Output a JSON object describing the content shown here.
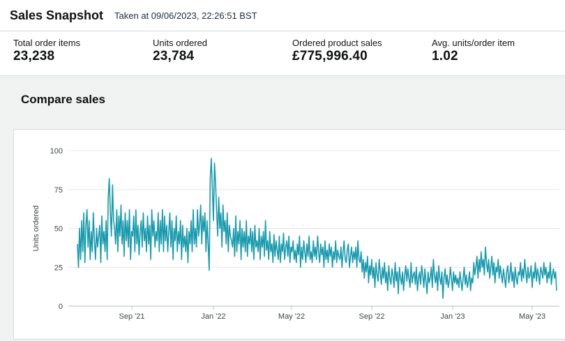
{
  "header": {
    "title": "Sales Snapshot",
    "taken_at": "Taken at 09/06/2023, 22:26:51 BST"
  },
  "metrics": [
    {
      "label": "Total order items",
      "value": "23,238"
    },
    {
      "label": "Units ordered",
      "value": "23,784"
    },
    {
      "label": "Ordered product sales",
      "value": "£775,996.40"
    },
    {
      "label": "Avg. units/order item",
      "value": "1.02"
    }
  ],
  "compare": {
    "title": "Compare sales"
  },
  "colors": {
    "line": "#1a9aad",
    "grid": "#e3e6e6",
    "axis": "#bbbfbf"
  },
  "chart_data": {
    "type": "line",
    "title": "",
    "xlabel": "",
    "ylabel": "Units ordered",
    "ylim": [
      0,
      100
    ],
    "y_ticks": [
      "0",
      "25",
      "50",
      "75",
      "100"
    ],
    "x_ticks": [
      "Sep '21",
      "Jan '22",
      "May '22",
      "Sep '22",
      "Jan '23",
      "May '23"
    ],
    "grid": true,
    "series": [
      {
        "values": [
          40,
          25,
          50,
          30,
          55,
          35,
          60,
          28,
          52,
          62,
          38,
          55,
          30,
          48,
          35,
          60,
          42,
          30,
          50,
          38,
          45,
          52,
          28,
          58,
          40,
          48,
          35,
          55,
          30,
          70,
          82,
          60,
          45,
          78,
          55,
          50,
          40,
          62,
          35,
          58,
          45,
          65,
          40,
          55,
          32,
          60,
          42,
          55,
          38,
          62,
          30,
          48,
          45,
          58,
          35,
          62,
          40,
          52,
          33,
          48,
          55,
          38,
          60,
          42,
          50,
          35,
          58,
          40,
          52,
          30,
          62,
          45,
          55,
          38,
          48,
          42,
          60,
          35,
          55,
          40,
          62,
          35,
          58,
          42,
          52,
          35,
          48,
          60,
          38,
          55,
          30,
          50,
          42,
          58,
          35,
          48,
          40,
          55,
          30,
          52,
          38,
          45,
          35,
          50,
          28,
          48,
          40,
          55,
          35,
          62,
          40,
          50,
          38,
          62,
          45,
          52,
          65,
          40,
          58,
          48,
          60,
          35,
          55,
          40,
          23,
          82,
          95,
          75,
          55,
          92,
          80,
          62,
          45,
          70,
          50,
          60,
          38,
          65,
          48,
          55,
          40,
          60,
          35,
          52,
          45,
          42,
          38,
          50,
          32,
          58,
          35,
          48,
          40,
          55,
          30,
          50,
          38,
          48,
          35,
          55,
          32,
          45,
          40,
          50,
          35,
          48,
          30,
          52,
          38,
          42,
          35,
          50,
          30,
          45,
          38,
          48,
          32,
          55,
          36,
          42,
          30,
          48,
          35,
          40,
          28,
          46,
          32,
          42,
          36,
          30,
          45,
          28,
          40,
          35,
          47,
          30,
          38,
          42,
          32,
          45,
          28,
          38,
          35,
          42,
          30,
          36,
          28,
          40,
          33,
          45,
          25,
          38,
          30,
          42,
          35,
          28,
          40,
          32,
          45,
          30,
          35,
          28,
          42,
          32,
          38,
          30,
          45,
          35,
          28,
          40,
          33,
          38,
          25,
          42,
          30,
          36,
          28,
          40,
          32,
          38,
          25,
          35,
          30,
          42,
          28,
          36,
          32,
          30,
          38,
          25,
          35,
          42,
          30,
          28,
          36,
          40,
          25,
          32,
          38,
          28,
          35,
          30,
          38,
          25,
          42,
          30,
          28,
          35,
          22,
          30,
          18,
          28,
          22,
          32,
          15,
          26,
          20,
          30,
          18,
          25,
          12,
          28,
          20,
          16,
          30,
          22,
          14,
          25,
          18,
          28,
          15,
          22,
          10,
          26,
          18,
          14,
          24,
          20,
          12,
          28,
          16,
          22,
          8,
          25,
          18,
          14,
          22,
          10,
          20,
          26,
          16,
          24,
          18,
          12,
          28,
          15,
          20,
          22,
          14,
          25,
          10,
          18,
          22,
          14,
          26,
          20,
          12,
          24,
          16,
          8,
          22,
          15,
          18,
          25,
          12,
          30,
          20,
          15,
          22,
          10,
          26,
          18,
          14,
          22,
          5,
          18,
          24,
          14,
          20,
          12,
          16,
          25,
          18,
          10,
          22,
          15,
          20,
          14,
          18,
          12,
          22,
          16,
          10,
          18,
          25,
          14,
          20,
          12,
          16,
          22,
          10,
          18,
          15,
          28,
          20,
          25,
          32,
          18,
          30,
          22,
          35,
          25,
          30,
          20,
          38,
          28,
          22,
          30,
          18,
          25,
          32,
          20,
          28,
          15,
          25,
          22,
          30,
          18,
          26,
          20,
          15,
          24,
          18,
          12,
          22,
          26,
          15,
          20,
          28,
          16,
          22,
          12,
          25,
          18,
          14,
          22,
          20,
          28,
          16,
          24,
          18,
          30,
          22,
          15,
          25,
          18,
          20,
          26,
          12,
          22,
          18,
          28,
          16,
          24,
          20,
          14,
          25,
          22,
          18,
          28,
          20,
          25,
          15,
          22,
          18,
          28,
          14,
          20,
          24,
          18,
          22,
          10
        ]
      }
    ]
  }
}
